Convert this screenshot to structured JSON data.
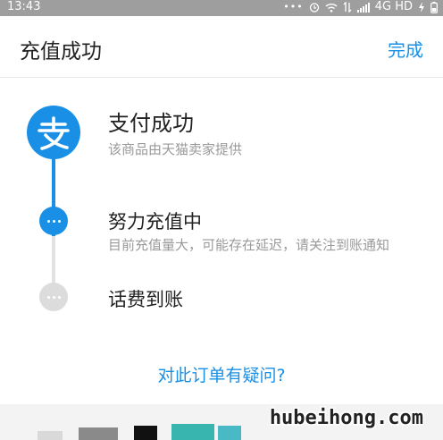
{
  "status_bar": {
    "time": "13:43",
    "dots": "•••",
    "network": "4G HD"
  },
  "header": {
    "title": "充值成功",
    "done_label": "完成"
  },
  "steps": [
    {
      "title": "支付成功",
      "desc": "该商品由天猫卖家提供",
      "icon": "alipay-icon",
      "state": "done"
    },
    {
      "title": "努力充值中",
      "desc": "目前充值量大，可能存在延迟，请关注到账通知",
      "icon": "more-dots-icon",
      "state": "active"
    },
    {
      "title": "话费到账",
      "icon": "more-dots-icon",
      "state": "pending"
    }
  ],
  "help_link": "对此订单有疑问?",
  "watermark": "hubeihong.com",
  "colors": {
    "accent": "#1a8fe6",
    "status_bar": "#9e9e9e",
    "pending": "#dcdcdc"
  }
}
